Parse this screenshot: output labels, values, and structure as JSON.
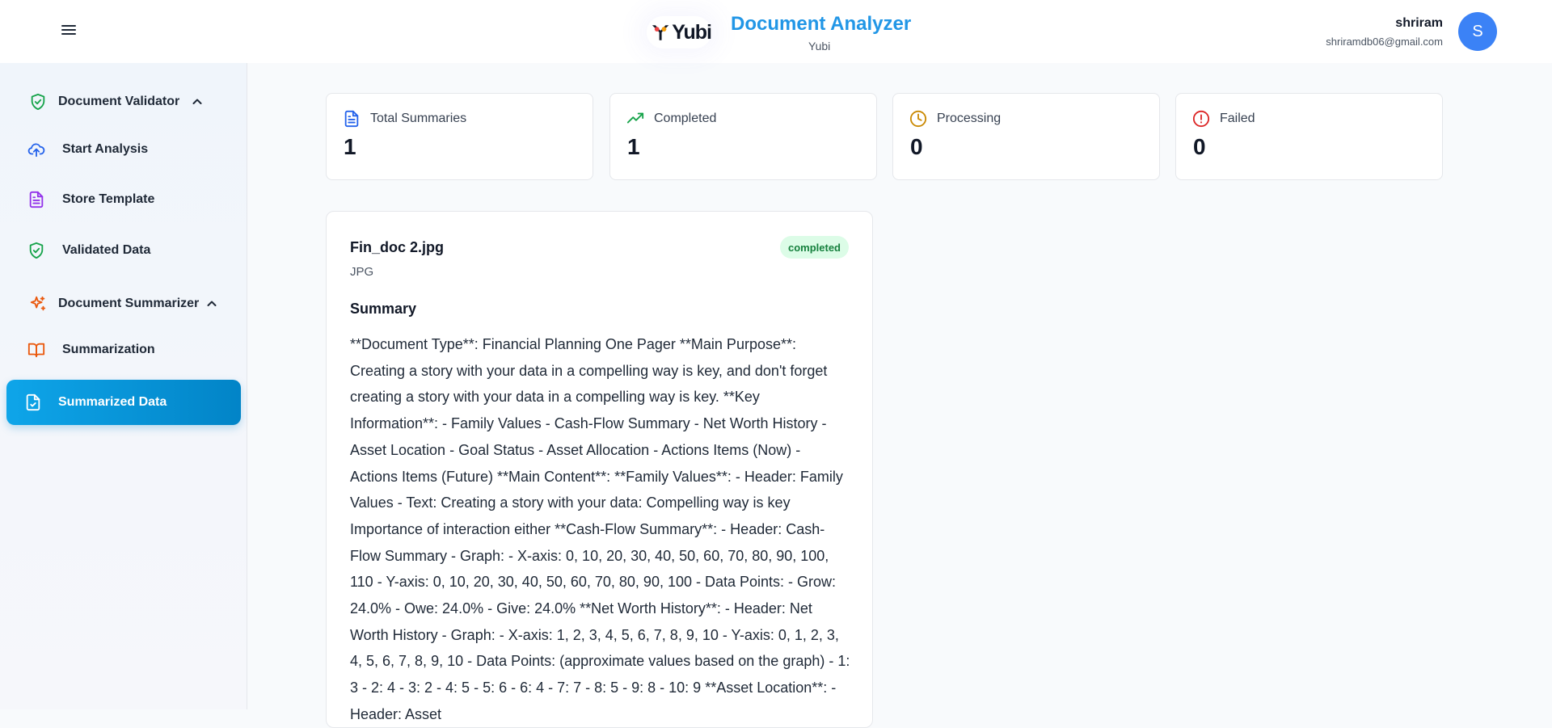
{
  "header": {
    "logo_text": "Yubi",
    "app_title": "Document Analyzer",
    "app_subtitle": "Yubi",
    "user_name": "shriram",
    "user_email": "shriramdb06@gmail.com",
    "avatar_initial": "S"
  },
  "sidebar": {
    "validator_section": "Document Validator",
    "validator_items": [
      "Start Analysis",
      "Store Template",
      "Validated Data"
    ],
    "summarizer_section": "Document Summarizer",
    "summarizer_items": [
      "Summarization",
      "Summarized Data"
    ],
    "active_item": "Summarized Data"
  },
  "stats": [
    {
      "label": "Total Summaries",
      "value": "1",
      "icon": "document-icon",
      "color": "#2563eb"
    },
    {
      "label": "Completed",
      "value": "1",
      "icon": "trending-up-icon",
      "color": "#16a34a"
    },
    {
      "label": "Processing",
      "value": "0",
      "icon": "clock-icon",
      "color": "#ca8a04"
    },
    {
      "label": "Failed",
      "value": "0",
      "icon": "alert-circle-icon",
      "color": "#dc2626"
    }
  ],
  "summary_card": {
    "file_name": "Fin_doc 2.jpg",
    "file_type": "JPG",
    "status": "completed",
    "summary_heading": "Summary",
    "summary_text": "**Document Type**: Financial Planning One Pager **Main Purpose**: Creating a story with your data in a compelling way is key, and don't forget creating a story with your data in a compelling way is key. **Key Information**: - Family Values - Cash-Flow Summary - Net Worth History - Asset Location - Goal Status - Asset Allocation - Actions Items (Now) - Actions Items (Future) **Main Content**: **Family Values**: - Header: Family Values - Text: Creating a story with your data: Compelling way is key Importance of interaction either **Cash-Flow Summary**: - Header: Cash-Flow Summary - Graph: - X-axis: 0, 10, 20, 30, 40, 50, 60, 70, 80, 90, 100, 110 - Y-axis: 0, 10, 20, 30, 40, 50, 60, 70, 80, 90, 100 - Data Points: - Grow: 24.0% - Owe: 24.0% - Give: 24.0% **Net Worth History**: - Header: Net Worth History - Graph: - X-axis: 1, 2, 3, 4, 5, 6, 7, 8, 9, 10 - Y-axis: 0, 1, 2, 3, 4, 5, 6, 7, 8, 9, 10 - Data Points: (approximate values based on the graph) - 1: 3 - 2: 4 - 3: 2 - 4: 5 - 5: 6 - 6: 4 - 7: 7 - 8: 5 - 9: 8 - 10: 9 **Asset Location**: - Header: Asset"
  },
  "colors": {
    "accent": "#2196e6",
    "active_nav": "#0ea5e9",
    "validator_icon": "#16a34a",
    "summarizer_icon": "#ea580c",
    "upload_icon": "#2563eb",
    "template_icon": "#9333ea"
  }
}
